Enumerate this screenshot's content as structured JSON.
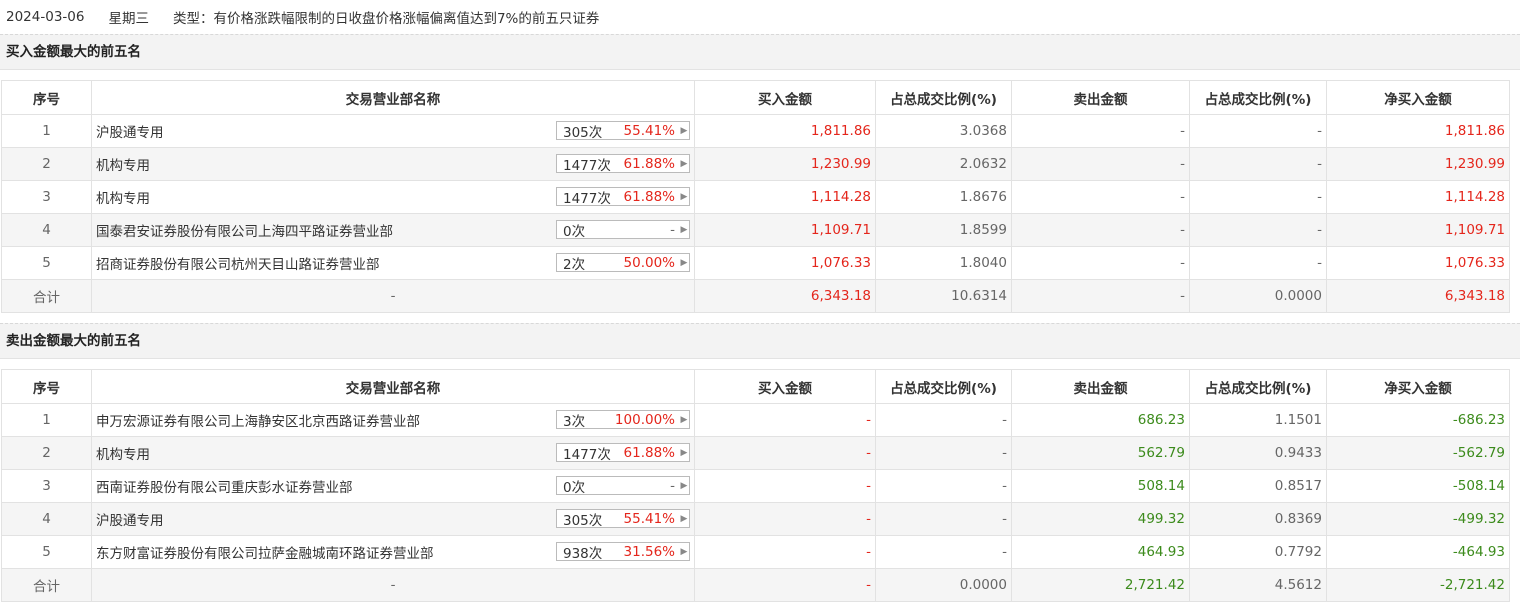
{
  "header": {
    "date": "2024-03-06",
    "weekday": "星期三",
    "type_label": "类型：有价格涨跌幅限制的日收盘价格涨幅偏离值达到7%的前五只证券"
  },
  "columns": [
    "序号",
    "交易营业部名称",
    "买入金额",
    "占总成交比例(%)",
    "卖出金额",
    "占总成交比例(%)",
    "净买入金额"
  ],
  "buy": {
    "title": "买入金额最大的前五名",
    "rows": [
      {
        "idx": "1",
        "name": "沪股通专用",
        "cnt": "305次",
        "pct": "55.41%",
        "buy": "1,811.86",
        "buy_ratio": "3.0368",
        "sell": "-",
        "sell_ratio": "-",
        "net": "1,811.86"
      },
      {
        "idx": "2",
        "name": "机构专用",
        "cnt": "1477次",
        "pct": "61.88%",
        "buy": "1,230.99",
        "buy_ratio": "2.0632",
        "sell": "-",
        "sell_ratio": "-",
        "net": "1,230.99"
      },
      {
        "idx": "3",
        "name": "机构专用",
        "cnt": "1477次",
        "pct": "61.88%",
        "buy": "1,114.28",
        "buy_ratio": "1.8676",
        "sell": "-",
        "sell_ratio": "-",
        "net": "1,114.28"
      },
      {
        "idx": "4",
        "name": "国泰君安证券股份有限公司上海四平路证券营业部",
        "cnt": "0次",
        "pct": "-",
        "buy": "1,109.71",
        "buy_ratio": "1.8599",
        "sell": "-",
        "sell_ratio": "-",
        "net": "1,109.71"
      },
      {
        "idx": "5",
        "name": "招商证券股份有限公司杭州天目山路证券营业部",
        "cnt": "2次",
        "pct": "50.00%",
        "buy": "1,076.33",
        "buy_ratio": "1.8040",
        "sell": "-",
        "sell_ratio": "-",
        "net": "1,076.33"
      }
    ],
    "total": {
      "label": "合计",
      "name": "-",
      "buy": "6,343.18",
      "buy_ratio": "10.6314",
      "sell": "-",
      "sell_ratio": "0.0000",
      "net": "6,343.18"
    }
  },
  "sell": {
    "title": "卖出金额最大的前五名",
    "rows": [
      {
        "idx": "1",
        "name": "申万宏源证券有限公司上海静安区北京西路证券营业部",
        "cnt": "3次",
        "pct": "100.00%",
        "buy": "-",
        "buy_ratio": "-",
        "sell": "686.23",
        "sell_ratio": "1.1501",
        "net": "-686.23"
      },
      {
        "idx": "2",
        "name": "机构专用",
        "cnt": "1477次",
        "pct": "61.88%",
        "buy": "-",
        "buy_ratio": "-",
        "sell": "562.79",
        "sell_ratio": "0.9433",
        "net": "-562.79"
      },
      {
        "idx": "3",
        "name": "西南证券股份有限公司重庆彭水证券营业部",
        "cnt": "0次",
        "pct": "-",
        "buy": "-",
        "buy_ratio": "-",
        "sell": "508.14",
        "sell_ratio": "0.8517",
        "net": "-508.14"
      },
      {
        "idx": "4",
        "name": "沪股通专用",
        "cnt": "305次",
        "pct": "55.41%",
        "buy": "-",
        "buy_ratio": "-",
        "sell": "499.32",
        "sell_ratio": "0.8369",
        "net": "-499.32"
      },
      {
        "idx": "5",
        "name": "东方财富证券股份有限公司拉萨金融城南环路证券营业部",
        "cnt": "938次",
        "pct": "31.56%",
        "buy": "-",
        "buy_ratio": "-",
        "sell": "464.93",
        "sell_ratio": "0.7792",
        "net": "-464.93"
      }
    ],
    "total": {
      "label": "合计",
      "name": "-",
      "buy": "-",
      "buy_ratio": "0.0000",
      "sell": "2,721.42",
      "sell_ratio": "4.5612",
      "net": "-2,721.42"
    }
  }
}
